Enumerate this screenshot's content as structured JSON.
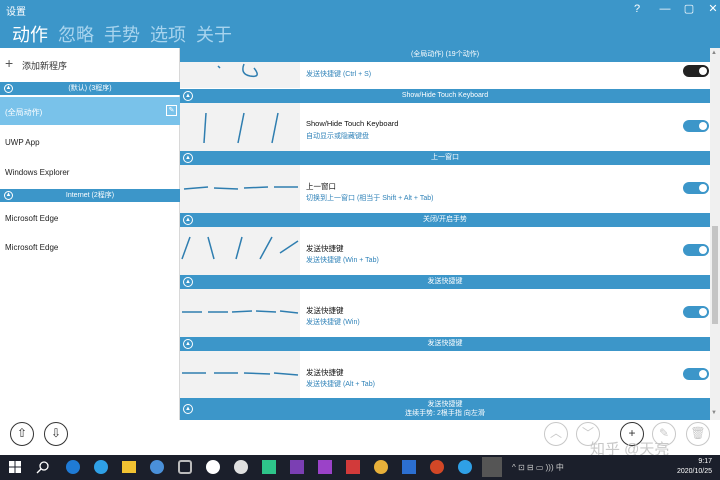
{
  "window": {
    "title": "设置",
    "help": "?",
    "minimize": "—",
    "restore": "▢",
    "close": "✕"
  },
  "menu": [
    "动作",
    "忽略",
    "手势",
    "选项",
    "关于"
  ],
  "left": {
    "add_label": "添加新程序",
    "groups": [
      {
        "label": "(默认) (3程序)",
        "items": [
          "(全局动作)",
          "UWP App",
          "Windows Explorer"
        ]
      },
      {
        "label": "Internet (2程序)",
        "items": [
          "Microsoft Edge",
          "Microsoft Edge"
        ]
      }
    ]
  },
  "sections": [
    {
      "header": "(全局动作) (19个动作)",
      "title": "",
      "subtitle": "发送快捷键 (Ctrl + S)"
    },
    {
      "header": "Show/Hide Touch Keyboard",
      "title": "Show/Hide Touch Keyboard",
      "subtitle": "自动显示或隐藏键盘"
    },
    {
      "header": "上一窗口",
      "title": "上一窗口",
      "subtitle": "切换到上一窗口 (相当于 Shift + Alt + Tab)"
    },
    {
      "header": "关闭/开启手势",
      "title": "发送快捷键",
      "subtitle": "发送快捷键 (Win + Tab)"
    },
    {
      "header": "发送快捷键",
      "title": "发送快捷键",
      "subtitle": "发送快捷键 (Win)"
    },
    {
      "header": "发送快捷键",
      "title": "发送快捷键",
      "subtitle": "发送快捷键 (Alt + Tab)"
    },
    {
      "header": "发送快捷键",
      "title": "连续手势: 2根手指 向左滑",
      "subtitle": ""
    }
  ],
  "clock": {
    "time": "9:17",
    "date": "2020/10/25"
  },
  "watermark": "知乎 @天亮",
  "colors": {
    "accent": "#3c96c9",
    "selected": "#79c2ea",
    "taskbar": "#1b1f2b"
  }
}
